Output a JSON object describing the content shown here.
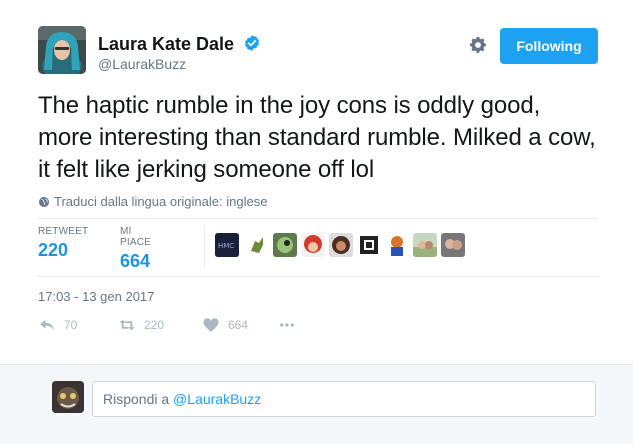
{
  "tweet": {
    "author": {
      "name": "Laura Kate Dale",
      "handle": "@LaurakBuzz",
      "verified": true
    },
    "follow_button_label": "Following",
    "text": "The haptic rumble in the joy cons is oddly good, more interesting than standard rumble. Milked a cow, it felt like jerking someone off lol",
    "translate_label": "Traduci dalla lingua originale: inglese",
    "stats": {
      "retweets_label": "RETWEET",
      "retweets_value": "220",
      "likes_label": "MI PIACE",
      "likes_value": "664"
    },
    "likers": [
      "liker-avatar-1",
      "liker-avatar-2",
      "liker-avatar-3",
      "liker-avatar-4",
      "liker-avatar-5",
      "liker-avatar-6",
      "liker-avatar-7",
      "liker-avatar-8",
      "liker-avatar-9"
    ],
    "timestamp": "17:03 - 13 gen 2017",
    "actions": {
      "reply_count": "70",
      "retweet_count": "220",
      "like_count": "664"
    }
  },
  "reply": {
    "prefix": "Rispondi a ",
    "mention": "@LaurakBuzz"
  },
  "colors": {
    "accent": "#1da1f2",
    "stat_value": "#1b95e0",
    "muted": "#657786",
    "icon_muted": "#aab8c2",
    "reply_bg": "#f5f8fa"
  },
  "icons": {
    "verified": "verified-badge-icon",
    "gear": "gear-icon",
    "globe": "globe-icon",
    "reply": "reply-icon",
    "retweet": "retweet-icon",
    "like": "heart-icon",
    "more": "more-dots-icon"
  }
}
